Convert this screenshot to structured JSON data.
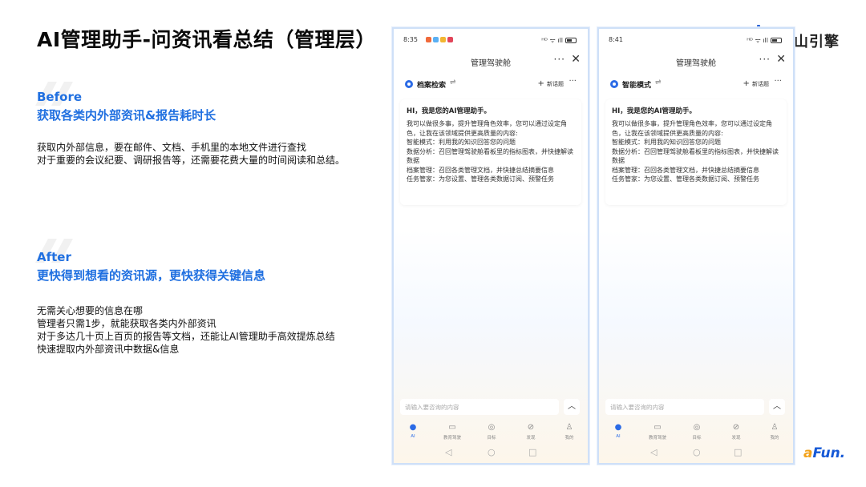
{
  "slide": {
    "title": "AI管理助手-问资讯看总结（管理层）",
    "brand": "山引擎",
    "footer_brand_a": "a",
    "footer_brand_b": "Fun."
  },
  "before": {
    "label": "Before",
    "headline": "获取各类内外部资讯&报告耗时长",
    "lines": [
      "获取内外部信息，要在邮件、文档、手机里的本地文件进行查找",
      "对于重要的会议纪要、调研报告等，还需要花费大量的时间阅读和总结。"
    ]
  },
  "after": {
    "label": "After",
    "headline": "更快得到想看的资讯源，更快获得关键信息",
    "lines": [
      "无需关心想要的信息在哪",
      "管理者只需1步，就能获取各类内外部资讯",
      "对于多达几十页上百页的报告等文档，还能让AI管理助手高效提炼总结",
      "快速提取内外部资讯中数据&信息"
    ]
  },
  "phones": [
    {
      "status_time": "8:35",
      "status_icons": "ᴴᴰ ᯤ ıll",
      "nav_title": "管理驾驶舱",
      "nav_more": "···",
      "nav_close": "✕",
      "mode_name": "档案检索",
      "mode_switch": "⇌",
      "new_topic": "新话题",
      "mode_more": "···",
      "greeting": "HI，我是您的AI管理助手。",
      "intro": "我可以做很多事，提升管理角色效率，您可以通过设定角色，让我在该领域提供更高质量的内容:",
      "features": [
        "智能模式：利用我的知识回答您的问题",
        "数据分析：召回管理驾驶舱看板里的指标图表，并快捷解读数据",
        "档案管理：召回各类管理文档，并快捷总结摘要信息",
        "任务管家：为您设置、管理各类数据订阅、预警任务"
      ],
      "input_placeholder": "请输入要咨询的内容",
      "tabs": [
        "AI",
        "教育驾驶",
        "目标",
        "发现",
        "我的"
      ]
    },
    {
      "status_time": "8:41",
      "status_icons": "ᴴᴰ ᯤ ıll",
      "nav_title": "管理驾驶舱",
      "nav_more": "···",
      "nav_close": "✕",
      "mode_name": "智能模式",
      "mode_switch": "⇌",
      "new_topic": "新话题",
      "mode_more": "···",
      "greeting": "HI，我是您的AI管理助手。",
      "intro": "我可以做很多事，提升管理角色效率，您可以通过设定角色，让我在该领域提供更高质量的内容:",
      "features": [
        "智能模式：利用我的知识回答您的问题",
        "数据分析：召回管理驾驶舱看板里的指标图表，并快捷解读数据",
        "档案管理：召回各类管理文档，并快捷总结摘要信息",
        "任务管家：为您设置、管理各类数据订阅、预警任务"
      ],
      "input_placeholder": "请输入要咨询的内容",
      "tabs": [
        "AI",
        "教育驾驶",
        "目标",
        "发现",
        "我的"
      ]
    }
  ],
  "colors": {
    "accent": "#1f6fe0",
    "phone_border": "#cfe0f8",
    "tab_active": "#2b6be6"
  }
}
